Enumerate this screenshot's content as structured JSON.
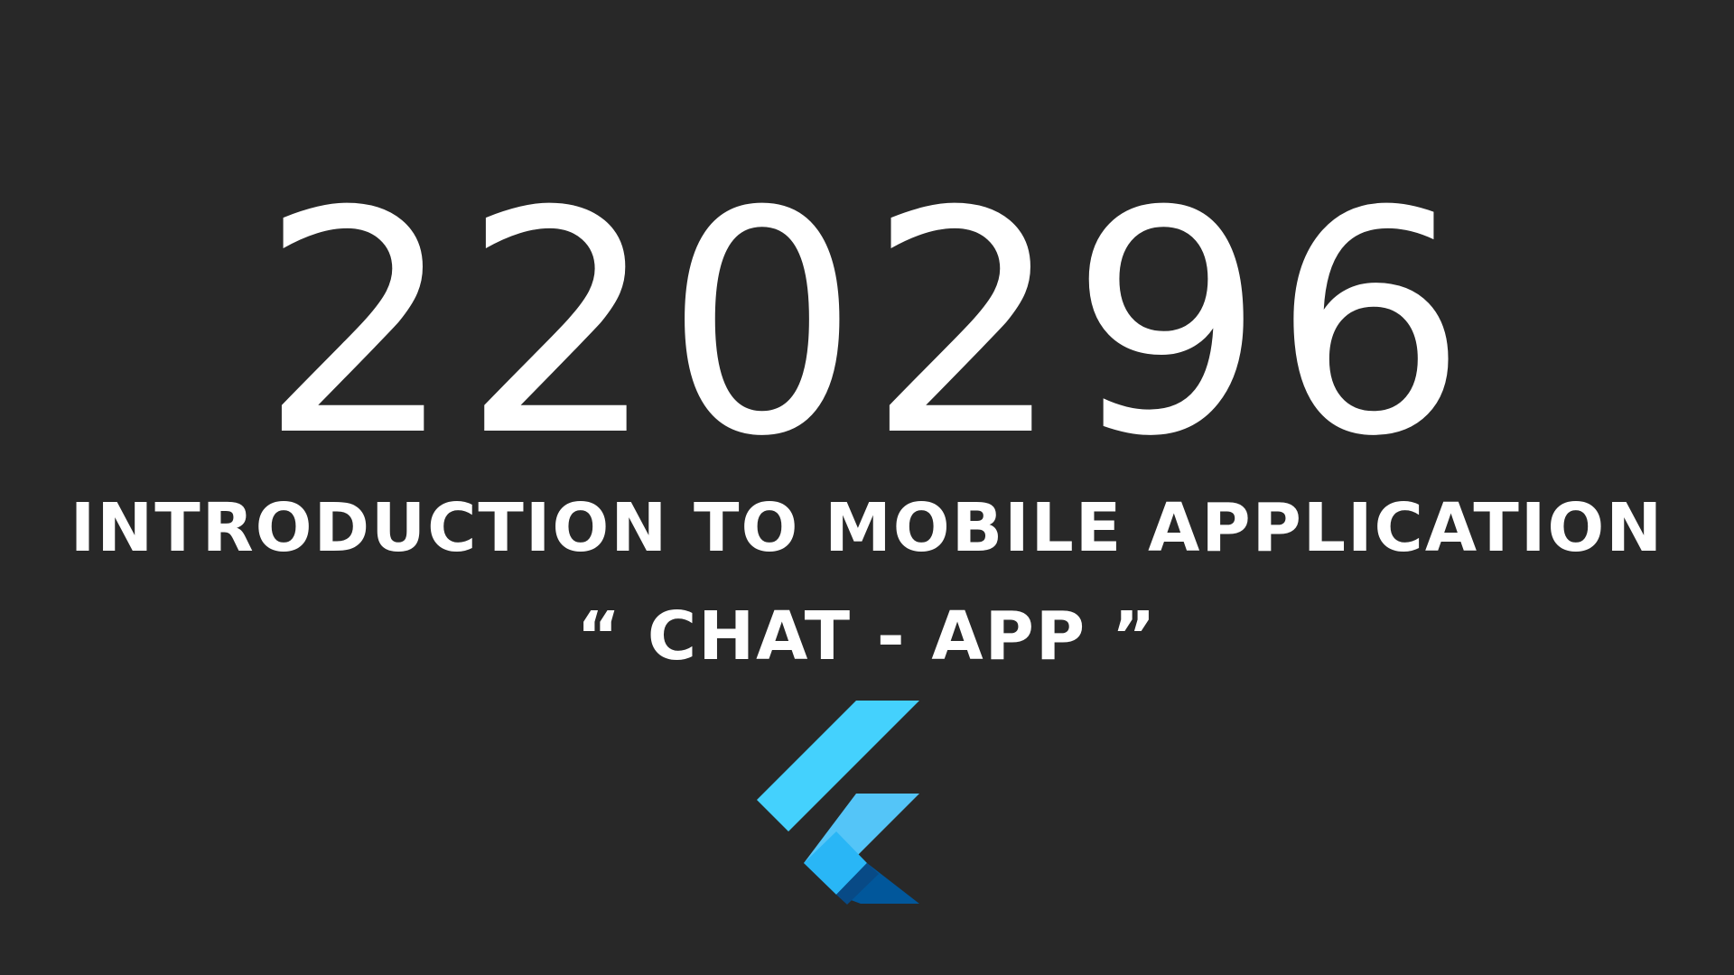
{
  "slide": {
    "course_code": "220296",
    "course_title": "INTRODUCTION TO MOBILE APPLICATION",
    "project_name": "“ CHAT - APP ”",
    "logo_icon": "flutter-logo-icon"
  },
  "colors": {
    "background": "#282828",
    "text": "#ffffff",
    "logo_light_blue": "#44D1FD",
    "logo_mid_blue": "#1FBCFD",
    "logo_dark_blue": "#08589C"
  }
}
